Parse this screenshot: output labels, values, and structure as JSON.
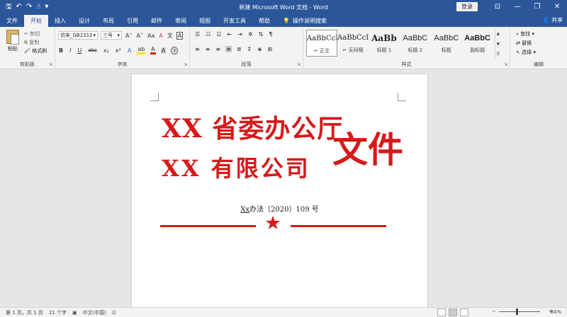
{
  "titlebar": {
    "title": "新建 Microsoft Word 文档 - Word",
    "login": "登录",
    "minimize_glyph": "—",
    "restore_glyph": "❐",
    "close_glyph": "✕",
    "options_glyph": "⊡"
  },
  "tabs": [
    "文件",
    "开始",
    "插入",
    "设计",
    "布局",
    "引用",
    "邮件",
    "审阅",
    "视图",
    "开发工具",
    "帮助"
  ],
  "active_tab": "开始",
  "search": {
    "placeholder": "操作说明搜索"
  },
  "share": "共享",
  "ribbon": {
    "clipboard": {
      "paste": "粘贴",
      "cut": "剪切",
      "copy": "复制",
      "format_painter": "格式刷",
      "label": "剪贴板"
    },
    "font": {
      "name": "仿宋_GB2312",
      "size": "三号",
      "grow": "A˄",
      "shrink": "A˅",
      "case": "Aa",
      "clear": "A",
      "phonetic": "文",
      "border_char": "A",
      "bold": "B",
      "italic": "I",
      "underline": "U",
      "strike": "abc",
      "sub": "x₂",
      "sup": "x²",
      "effects": "A",
      "highlight": "ab",
      "color": "A",
      "shade": "A",
      "circle": "字",
      "label": "字体"
    },
    "paragraph": {
      "label": "段落"
    },
    "styles": {
      "label": "样式",
      "items": [
        {
          "sample": "AaBbCcDc",
          "name": "↵ 正文"
        },
        {
          "sample": "AaBbCcDc",
          "name": "↵ 无间隔"
        },
        {
          "sample": "AaBb",
          "name": "标题 1"
        },
        {
          "sample": "AaBbC",
          "name": "标题 2"
        },
        {
          "sample": "AaBbC",
          "name": "标题"
        },
        {
          "sample": "AaBbC",
          "name": "副标题"
        }
      ]
    },
    "editing": {
      "find": "查找",
      "replace": "替换",
      "select": "选择",
      "label": "编辑"
    }
  },
  "document": {
    "line1": "XX 省委办公厅",
    "line2": "XX 有限公司",
    "big": "文件",
    "docno_prefix": "Xx",
    "docno_rest": "办法〔2020〕109 号"
  },
  "colors": {
    "accent": "#2b579a",
    "red": "#d61a1a"
  },
  "status": {
    "page": "第 1 页，共 1 页",
    "words": "21 个字",
    "lang": "中文(中国)",
    "zoom": "84%",
    "zoom_level": 0.84
  }
}
